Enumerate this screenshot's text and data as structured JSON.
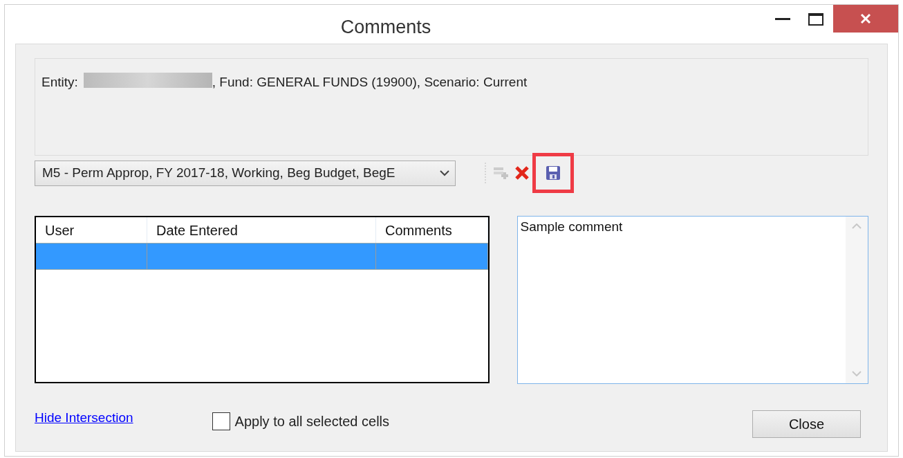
{
  "window": {
    "title": "Comments"
  },
  "intersection": {
    "entity_label": "Entity:",
    "rest": ", Fund: GENERAL FUNDS (19900), Scenario: Current"
  },
  "version_select": {
    "value": "M5 - Perm Approp, FY 2017-18, Working, Beg Budget, BegE"
  },
  "toolbar": [
    {
      "kind": "add",
      "disabled": true,
      "highlighted": false
    },
    {
      "kind": "delete",
      "disabled": false,
      "highlighted": false
    },
    {
      "kind": "save",
      "disabled": false,
      "highlighted": true
    }
  ],
  "grid": {
    "columns": [
      "User",
      "Date Entered",
      "Comments"
    ],
    "rows": [
      {
        "selected": true
      }
    ]
  },
  "comment_box": {
    "value": "Sample comment"
  },
  "hide_link": "Hide Intersection",
  "apply_all": {
    "label": "Apply to all selected cells",
    "checked": false
  },
  "close_button": "Close"
}
